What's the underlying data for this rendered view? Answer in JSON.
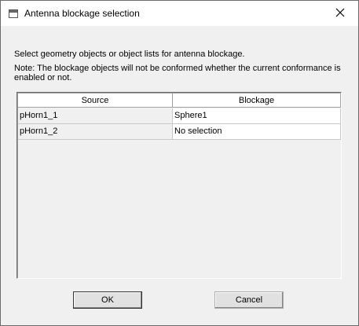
{
  "window": {
    "title": "Antenna blockage selection",
    "app_icon": "window-icon",
    "close_icon": "close-icon"
  },
  "description": {
    "line1": "Select geometry objects or object lists for antenna blockage.",
    "note": "Note: The blockage objects will not be conformed whether the current conformance is enabled or not."
  },
  "table": {
    "headers": {
      "source": "Source",
      "blockage": "Blockage"
    },
    "rows": [
      {
        "source": "pHorn1_1",
        "blockage": "Sphere1"
      },
      {
        "source": "pHorn1_2",
        "blockage": "No selection"
      }
    ]
  },
  "buttons": {
    "ok": "OK",
    "cancel": "Cancel"
  }
}
